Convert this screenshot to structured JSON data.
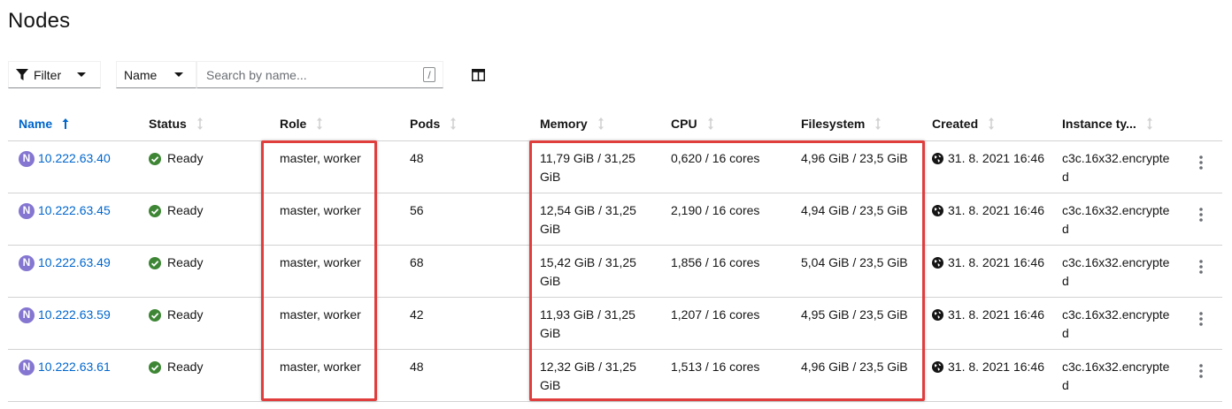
{
  "page": {
    "title": "Nodes"
  },
  "toolbar": {
    "filter_label": "Filter",
    "name_select_value": "Name",
    "search_placeholder": "Search by name...",
    "search_shortcut": "/"
  },
  "table": {
    "headers": [
      "Name",
      "Status",
      "Role",
      "Pods",
      "Memory",
      "CPU",
      "Filesystem",
      "Created",
      "Instance ty..."
    ],
    "rows": [
      {
        "badge": "N",
        "name": "10.222.63.40",
        "status": "Ready",
        "role": "master, worker",
        "pods": "48",
        "memory": "11,79 GiB / 31,25 GiB",
        "cpu": "0,620 / 16 cores",
        "filesystem": "4,96 GiB / 23,5 GiB",
        "created": "31. 8. 2021 16:46",
        "instance_type": "c3c.16x32.encrypted"
      },
      {
        "badge": "N",
        "name": "10.222.63.45",
        "status": "Ready",
        "role": "master, worker",
        "pods": "56",
        "memory": "12,54 GiB / 31,25 GiB",
        "cpu": "2,190 / 16 cores",
        "filesystem": "4,94 GiB / 23,5 GiB",
        "created": "31. 8. 2021 16:46",
        "instance_type": "c3c.16x32.encrypted"
      },
      {
        "badge": "N",
        "name": "10.222.63.49",
        "status": "Ready",
        "role": "master, worker",
        "pods": "68",
        "memory": "15,42 GiB / 31,25 GiB",
        "cpu": "1,856 / 16 cores",
        "filesystem": "5,04 GiB / 23,5 GiB",
        "created": "31. 8. 2021 16:46",
        "instance_type": "c3c.16x32.encrypted"
      },
      {
        "badge": "N",
        "name": "10.222.63.59",
        "status": "Ready",
        "role": "master, worker",
        "pods": "42",
        "memory": "11,93 GiB / 31,25 GiB",
        "cpu": "1,207 / 16 cores",
        "filesystem": "4,95 GiB / 23,5 GiB",
        "created": "31. 8. 2021 16:46",
        "instance_type": "c3c.16x32.encrypted"
      },
      {
        "badge": "N",
        "name": "10.222.63.61",
        "status": "Ready",
        "role": "master, worker",
        "pods": "48",
        "memory": "12,32 GiB / 31,25 GiB",
        "cpu": "1,513 / 16 cores",
        "filesystem": "4,96 GiB / 23,5 GiB",
        "created": "31. 8. 2021 16:46",
        "instance_type": "c3c.16x32.encrypted"
      }
    ]
  },
  "colors": {
    "link": "#0066cc",
    "node_badge": "#8476d1",
    "status_ok": "#3e8635",
    "highlight_box": "#e03d3d"
  },
  "icons": {
    "filter": "filter-funnel-icon",
    "columns": "manage-columns-icon",
    "status": "check-circle-icon",
    "created": "globe-icon",
    "row_actions": "kebab-icon"
  }
}
